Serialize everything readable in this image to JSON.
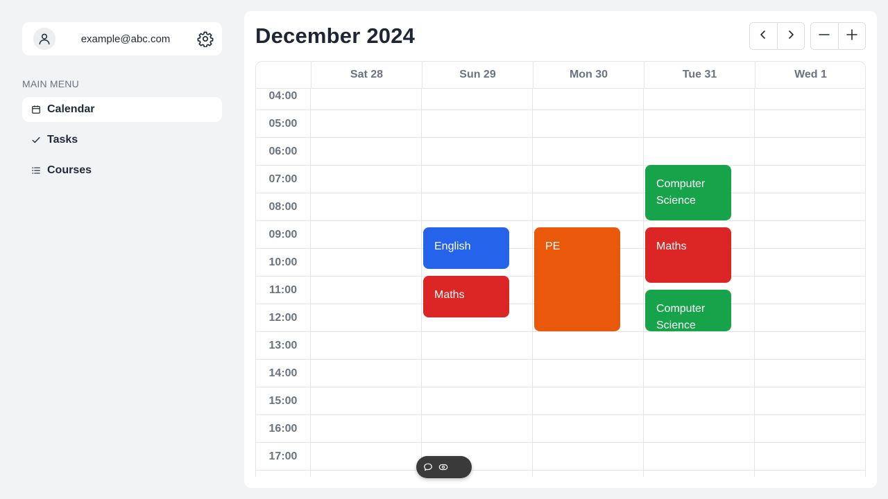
{
  "user": {
    "email": "example@abc.com"
  },
  "menu": {
    "title": "MAIN MENU",
    "items": [
      {
        "label": "Calendar",
        "icon": "calendar-icon",
        "active": true
      },
      {
        "label": "Tasks",
        "icon": "check-icon",
        "active": false
      },
      {
        "label": "Courses",
        "icon": "list-icon",
        "active": false
      }
    ]
  },
  "calendar": {
    "title": "December 2024",
    "days": [
      "Sat 28",
      "Sun 29",
      "Mon 30",
      "Tue 31",
      "Wed 1"
    ],
    "times": [
      "04:00",
      "05:00",
      "06:00",
      "07:00",
      "08:00",
      "09:00",
      "10:00",
      "11:00",
      "12:00",
      "13:00",
      "14:00",
      "15:00",
      "16:00",
      "17:00"
    ],
    "events": [
      {
        "title": "English",
        "day": 1,
        "start": "09:00",
        "end": "10:30",
        "color": "#2563eb"
      },
      {
        "title": "Maths",
        "day": 1,
        "start": "10:45",
        "end": "12:15",
        "color": "#dc2626"
      },
      {
        "title": "PE",
        "day": 2,
        "start": "09:00",
        "end": "12:45",
        "color": "#ea580c"
      },
      {
        "title": "Computer Science",
        "day": 3,
        "start": "06:45",
        "end": "08:45",
        "color": "#16a34a"
      },
      {
        "title": "Maths",
        "day": 3,
        "start": "09:00",
        "end": "11:00",
        "color": "#dc2626"
      },
      {
        "title": "Computer Science",
        "day": 3,
        "start": "11:15",
        "end": "12:45",
        "color": "#16a34a"
      }
    ]
  },
  "toolbar": {
    "prev_icon": "chevron-left-icon",
    "next_icon": "chevron-right-icon",
    "zoom_out_icon": "minus-icon",
    "zoom_in_icon": "plus-icon"
  },
  "floating_bar": {
    "icons": [
      "comment-icon",
      "eye-icon"
    ]
  }
}
